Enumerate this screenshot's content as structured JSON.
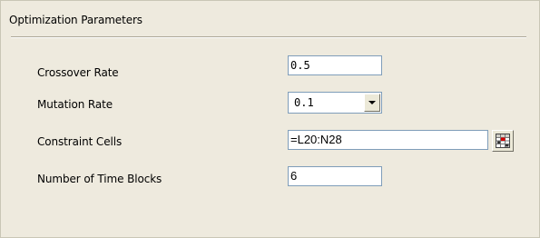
{
  "group": {
    "title": "Optimization Parameters"
  },
  "params": {
    "crossover_rate": {
      "label": "Crossover Rate",
      "value": "0.5"
    },
    "mutation_rate": {
      "label": "Mutation Rate",
      "value": "0.1"
    },
    "constraint_cells": {
      "label": "Constraint Cells",
      "value": "=L20:N28",
      "range_icon": "cell-range-picker-icon"
    },
    "time_blocks": {
      "label": "Number of Time Blocks",
      "value": "6"
    }
  },
  "colors": {
    "panel_background": "#ece9d8",
    "field_border": "#7f9db9",
    "separator": "#aca899",
    "range_icon_accent": "#d60000"
  }
}
